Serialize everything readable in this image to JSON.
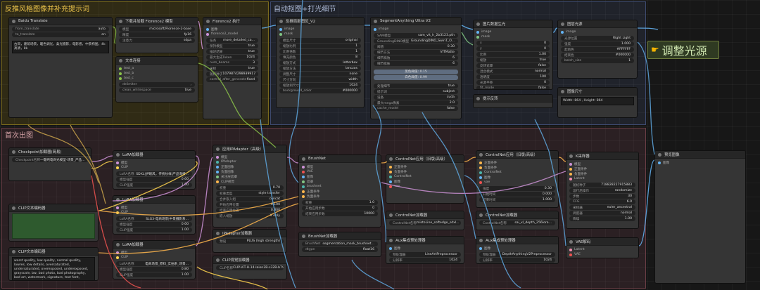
{
  "groups": [
    {
      "id": "g1",
      "title": "反推风格图像并补充提示词",
      "color": "#e8c14a",
      "bg": "rgba(140,120,20,0.22)",
      "border": "#7a6a1d"
    },
    {
      "id": "g2",
      "title": "自动抠图+打光细节",
      "color": "#aebbd8",
      "bg": "rgba(70,80,120,0.22)",
      "border": "#3d4a6e"
    },
    {
      "id": "g3",
      "title": "首次出图",
      "color": "#d7a4a8",
      "bg": "rgba(120,70,80,0.22)",
      "border": "#6a3d45"
    }
  ],
  "callout": {
    "icon": "pointing-hand-icon",
    "text": "调整光源"
  },
  "nodes": [
    {
      "id": "n1",
      "title": "Baidu Translate",
      "badge": "#285 MingNodes",
      "dot": "#888",
      "ports": [],
      "widgets": [
        {
          "k": "from_translate",
          "v": "auto"
        },
        {
          "k": "to_translate",
          "v": "en"
        }
      ],
      "text": "古风，建筑场景，暖色调光，柔光摄影，电影感，中景构图，4k高清，8k"
    },
    {
      "id": "n2",
      "title": "下载并加载 Florence2 模型",
      "badge": "#108 Florence2",
      "dot": "#888",
      "ports": [],
      "widgets": [
        {
          "k": "模型",
          "v": "microsoft/Florence-2-base"
        },
        {
          "k": "精度",
          "v": "fp16"
        },
        {
          "k": "注意力",
          "v": "sdpa"
        }
      ],
      "text": ""
    },
    {
      "id": "n3",
      "title": "文本连接",
      "badge": "",
      "dot": "#888",
      "ports": [
        {
          "n": "text_a",
          "c": "#8bc34a"
        },
        {
          "n": "text_b",
          "c": "#8bc34a"
        },
        {
          "n": "text_c",
          "c": "#8bc34a"
        }
      ],
      "widgets": [
        {
          "k": "delimiter",
          "v": ","
        },
        {
          "k": "clean_whitespace",
          "v": "true"
        }
      ],
      "text": ""
    },
    {
      "id": "n4",
      "title": "Florence2 执行",
      "badge": "#106 Florence2",
      "dot": "#888",
      "ports": [
        {
          "n": "图像",
          "c": "#64b5f6"
        },
        {
          "n": "florence2_model",
          "c": "#ce93d8"
        }
      ],
      "widgets": [
        {
          "k": "任务",
          "v": "more_detailed_ca..."
        },
        {
          "k": "保持模型",
          "v": "true"
        },
        {
          "k": "描述结果",
          "v": "true"
        },
        {
          "k": "最大生成Token",
          "v": "1024"
        },
        {
          "k": "num_beams",
          "v": "3"
        },
        {
          "k": "采样",
          "v": "true"
        },
        {
          "k": "随机种子",
          "v": "1079874298939917"
        },
        {
          "k": "control_after_generate",
          "v": "fixed"
        }
      ],
      "text": ""
    },
    {
      "id": "n5",
      "title": "反推局部图优_V2",
      "badge": "#200 LayerStyle",
      "dot": "#888",
      "ports": [
        {
          "n": "image",
          "c": "#64b5f6"
        },
        {
          "n": "mask",
          "c": "#81c784"
        }
      ],
      "widgets": [
        {
          "k": "模型尺寸",
          "v": "original"
        },
        {
          "k": "缩放比例",
          "v": "1"
        },
        {
          "k": "比例倍数",
          "v": "1"
        },
        {
          "k": "填充颜色",
          "v": "8"
        },
        {
          "k": "缩放方式",
          "v": "letterbox"
        },
        {
          "k": "缩放方法",
          "v": "lanczos"
        },
        {
          "k": "调整尺寸",
          "v": "none"
        },
        {
          "k": "尺寸方向",
          "v": "width"
        },
        {
          "k": "缩放到尺寸",
          "v": "1024"
        },
        {
          "k": "background_color",
          "v": "#000000"
        }
      ],
      "text": ""
    },
    {
      "id": "n6",
      "title": "SegmentAnything Ultra V2",
      "badge": "#64 LayerStyle",
      "dot": "#888",
      "ports": [
        {
          "n": "image",
          "c": "#64b5f6"
        }
      ],
      "widgets": [
        {
          "k": "SAM模型",
          "v": "sam_vit_h_2b3123.pth"
        },
        {
          "k": "GroundingDINO模型",
          "v": "GroundingDINO_SwinT_O..."
        },
        {
          "k": "阈值",
          "v": "0.30"
        },
        {
          "k": "细节方法",
          "v": "VITMatte"
        },
        {
          "k": "细节腐蚀",
          "v": "6"
        },
        {
          "k": "细节膨胀",
          "v": "6"
        }
      ],
      "buttons": [
        {
          "t": "黑色阈值: 0.15",
          "c": "blue"
        },
        {
          "t": "白色阈值: 0.99",
          "c": "blue"
        }
      ],
      "widgets2": [
        {
          "k": "处理细节",
          "v": "true"
        },
        {
          "k": "提示词",
          "v": "subject"
        },
        {
          "k": "设备",
          "v": "cuda"
        },
        {
          "k": "最大mega像素",
          "v": "2.0"
        },
        {
          "k": "cache_model",
          "v": "false"
        }
      ],
      "text": ""
    },
    {
      "id": "n7",
      "title": "图片数据生光",
      "badge": "#268 IC Nodes",
      "dot": "#888",
      "ports": [
        {
          "n": "image",
          "c": "#64b5f6"
        },
        {
          "n": "mask",
          "c": "#81c784"
        }
      ],
      "widgets": [
        {
          "k": "x",
          "v": "0"
        },
        {
          "k": "y",
          "v": "0"
        },
        {
          "k": "比例",
          "v": "1.00"
        },
        {
          "k": "缩放",
          "v": "true"
        },
        {
          "k": "反转遮罩",
          "v": "false"
        },
        {
          "k": "混合模式",
          "v": "normal"
        },
        {
          "k": "透明度",
          "v": "100"
        },
        {
          "k": "光源平移",
          "v": "0"
        },
        {
          "k": "fit_mode",
          "v": "false"
        }
      ],
      "text": ""
    },
    {
      "id": "n8",
      "title": "图层光源",
      "badge": "#159 IC-Light",
      "dot": "#888",
      "ports": [
        {
          "n": "image",
          "c": "#64b5f6"
        }
      ],
      "widgets": [
        {
          "k": "光源位置",
          "v": "Right Light"
        },
        {
          "k": "强度",
          "v": "1.000"
        },
        {
          "k": "起始色",
          "v": "#FFFFFF"
        },
        {
          "k": "结束色",
          "v": "#000000"
        },
        {
          "k": "batch_size",
          "v": "1"
        }
      ],
      "text": ""
    },
    {
      "id": "n9",
      "title": "图像尺寸",
      "badge": "#143 Easy-Use",
      "dot": "#888",
      "ports": [],
      "widgets": [],
      "text": "Width: 864 , Height: 864"
    },
    {
      "id": "n10",
      "title": "提示反转",
      "badge": "#127",
      "dot": "#888",
      "ports": [],
      "widgets": [],
      "text": ""
    },
    {
      "id": "n11",
      "title": "Checkpoint加载器(简易)",
      "badge": "#61",
      "dot": "#888",
      "ports": [],
      "widgets": [
        {
          "k": "Checkpoint名称",
          "v": "一键纯电商光模型-场景_产品..."
        }
      ],
      "text": ""
    },
    {
      "id": "n12",
      "title": "CLIP文本编码器",
      "badge": "#67",
      "dot": "#888",
      "ports": [],
      "widgets": [],
      "text": "",
      "green": true
    },
    {
      "id": "n13",
      "title": "CLIP文本编码器",
      "badge": "#68",
      "dot": "#888",
      "ports": [],
      "widgets": [],
      "text": "worst quality, low quality, normal quality, lowres, low details, oversaturated, undersaturated, overexposed, underexposed, grayscale, bw, bad photo, bad photography, bad art, watermark, signature, text font, username, error, logo"
    },
    {
      "id": "n14",
      "title": "LoRA加载器",
      "badge": "#63",
      "dot": "#888",
      "ports": [
        {
          "n": "模型",
          "c": "#ce93d8"
        },
        {
          "n": "CLIP",
          "c": "#ffd54f"
        }
      ],
      "widgets": [
        {
          "k": "LoRA名称",
          "v": "SDXL|护眼风，传统纹样|产品海报..."
        },
        {
          "k": "模型强度",
          "v": "0.60"
        },
        {
          "k": "CLIP强度",
          "v": "1.00"
        }
      ],
      "text": ""
    },
    {
      "id": "n15",
      "title": "LoRA加载器",
      "badge": "",
      "dot": "#888",
      "ports": [
        {
          "n": "模型",
          "c": "#ce93d8"
        },
        {
          "n": "CLIP",
          "c": "#ffd54f"
        }
      ],
      "widgets": [
        {
          "k": "LoRA名称",
          "v": "SLG3-电商场景|中景摄影系..."
        },
        {
          "k": "模型强度",
          "v": "0.60"
        },
        {
          "k": "CLIP强度",
          "v": "1.00"
        }
      ],
      "text": ""
    },
    {
      "id": "n16",
      "title": "LoRA加载器",
      "badge": "#269",
      "dot": "#888",
      "ports": [
        {
          "n": "模型",
          "c": "#ce93d8"
        },
        {
          "n": "CLIP",
          "c": "#ffd54f"
        }
      ],
      "widgets": [
        {
          "k": "LoRA名称",
          "v": "电商场景_原料_实拍系_场景..."
        },
        {
          "k": "模型强度",
          "v": "0.80"
        },
        {
          "k": "CLIP强度",
          "v": "1.00"
        }
      ],
      "text": ""
    },
    {
      "id": "n17",
      "title": "应用IPAdapter（高级）",
      "badge": "#85 IPAdapter_plus",
      "dot": "#888",
      "ports": [
        {
          "n": "模型",
          "c": "#ce93d8"
        },
        {
          "n": "IPAdapter",
          "c": "#4db6ac"
        },
        {
          "n": "正面图像",
          "c": "#64b5f6"
        },
        {
          "n": "负面图像",
          "c": "#64b5f6"
        },
        {
          "n": "关注层遮罩",
          "c": "#81c784"
        },
        {
          "n": "CLIP视觉",
          "c": "#ffb74d"
        }
      ],
      "widgets": [
        {
          "k": "权重",
          "v": "0.70"
        },
        {
          "k": "权重类型",
          "v": "style transfer"
        },
        {
          "k": "合并嵌入组",
          "v": "concat"
        },
        {
          "k": "开始应用位置",
          "v": "0.100"
        },
        {
          "k": "结束应用位置",
          "v": "0.800"
        },
        {
          "k": "嵌入缩放",
          "v": "V only"
        }
      ],
      "text": ""
    },
    {
      "id": "n18",
      "title": "IPAdapter加载器",
      "badge": "#82 IPAdapter_plus",
      "dot": "#888",
      "ports": [],
      "widgets": [
        {
          "k": "预设",
          "v": "PLUS (high strength)"
        }
      ],
      "text": ""
    },
    {
      "id": "n19",
      "title": "CLIP视觉加载器",
      "badge": "#83",
      "dot": "#888",
      "ports": [],
      "widgets": [
        {
          "k": "CLIP名称",
          "v": "CLIP-ViT-H-14-laion2B-s32B-b79K"
        }
      ],
      "text": ""
    },
    {
      "id": "n20",
      "title": "BrushNet",
      "badge": "#53 BrushNet",
      "dot": "#888",
      "ports": [
        {
          "n": "模型",
          "c": "#ce93d8"
        },
        {
          "n": "VAE",
          "c": "#ef5350"
        },
        {
          "n": "图像",
          "c": "#64b5f6"
        },
        {
          "n": "遮罩",
          "c": "#81c784"
        },
        {
          "n": "brushnet",
          "c": "#4db6ac"
        },
        {
          "n": "正面条件",
          "c": "#ffb74d"
        },
        {
          "n": "负面条件",
          "c": "#ffb74d"
        }
      ],
      "widgets": [
        {
          "k": "权重",
          "v": "1.0"
        },
        {
          "k": "开始应用步数",
          "v": "0"
        },
        {
          "k": "结束应用步数",
          "v": "10000"
        }
      ],
      "text": ""
    },
    {
      "id": "n21",
      "title": "BrushNet加载器",
      "badge": "",
      "dot": "#888",
      "ports": [],
      "widgets": [
        {
          "k": "BrushNet",
          "v": "segmentation_mask_brushnet..."
        },
        {
          "k": "dtype",
          "v": "float16"
        }
      ],
      "text": ""
    },
    {
      "id": "n22",
      "title": "ControlNet应用（旧版/高级）",
      "badge": "#81",
      "dot": "#888",
      "ports": [
        {
          "n": "正面条件",
          "c": "#ffb74d"
        },
        {
          "n": "负面条件",
          "c": "#ffb74d"
        },
        {
          "n": "ControlNet",
          "c": "#4db6ac"
        },
        {
          "n": "图像",
          "c": "#64b5f6"
        },
        {
          "n": "vae",
          "c": "#ef5350"
        }
      ],
      "widgets": [],
      "text": ""
    },
    {
      "id": "n23",
      "title": "ControlNet加载器",
      "badge": "",
      "dot": "#888",
      "ports": [],
      "widgets": [
        {
          "k": "ControlNet名称",
          "v": "mistoLine_softedge_sdxl..."
        }
      ],
      "text": ""
    },
    {
      "id": "n24",
      "title": "Aux集成预处理器",
      "badge": "",
      "dot": "#888",
      "ports": [
        {
          "n": "图像",
          "c": "#64b5f6"
        }
      ],
      "widgets": [
        {
          "k": "预处理器",
          "v": "LineArtPreprocessor"
        },
        {
          "k": "分辨率",
          "v": "1024"
        }
      ],
      "text": ""
    },
    {
      "id": "n25",
      "title": "ControlNet应用（旧版/高级）",
      "badge": "#256",
      "dot": "#888",
      "ports": [
        {
          "n": "正面条件",
          "c": "#ffb74d"
        },
        {
          "n": "负面条件",
          "c": "#ffb74d"
        },
        {
          "n": "ControlNet",
          "c": "#4db6ac"
        },
        {
          "n": "图像",
          "c": "#64b5f6"
        },
        {
          "n": "vae",
          "c": "#ef5350"
        }
      ],
      "widgets": [
        {
          "k": "强度",
          "v": "0.30"
        },
        {
          "k": "开始时间",
          "v": "0.000"
        },
        {
          "k": "结束时间",
          "v": "1.000"
        }
      ],
      "text": ""
    },
    {
      "id": "n26",
      "title": "ControlNet加载器",
      "badge": "",
      "dot": "#888",
      "ports": [],
      "widgets": [
        {
          "k": "ControlNet名称",
          "v": "sai_xl_depth_256lora..."
        }
      ],
      "text": ""
    },
    {
      "id": "n27",
      "title": "Aux集成预处理器",
      "badge": "",
      "dot": "#888",
      "ports": [
        {
          "n": "图像",
          "c": "#64b5f6"
        }
      ],
      "widgets": [
        {
          "k": "预处理器",
          "v": "DepthAnythingV2Preprocessor"
        },
        {
          "k": "分辨率",
          "v": "1024"
        }
      ],
      "text": ""
    },
    {
      "id": "n28",
      "title": "K采样器",
      "badge": "#55",
      "dot": "#888",
      "ports": [
        {
          "n": "模型",
          "c": "#ce93d8"
        },
        {
          "n": "正面条件",
          "c": "#ffb74d"
        },
        {
          "n": "负面条件",
          "c": "#ffb74d"
        },
        {
          "n": "Latent",
          "c": "#f48fb1"
        }
      ],
      "widgets": [
        {
          "k": "随机种子",
          "v": "718828227915883"
        },
        {
          "k": "运行后操作",
          "v": "randomize"
        },
        {
          "k": "步数",
          "v": "30"
        },
        {
          "k": "CFG",
          "v": "6.0"
        },
        {
          "k": "采样器",
          "v": "euler_ancestral"
        },
        {
          "k": "调度器",
          "v": "normal"
        },
        {
          "k": "降噪",
          "v": "1.00"
        }
      ],
      "text": ""
    },
    {
      "id": "n29",
      "title": "VAE解码",
      "badge": "#",
      "dot": "#888",
      "ports": [
        {
          "n": "Latent",
          "c": "#f48fb1"
        },
        {
          "n": "VAE",
          "c": "#ef5350"
        }
      ],
      "widgets": [],
      "text": ""
    },
    {
      "id": "n30",
      "title": "预览图像",
      "badge": "#221",
      "dot": "#888",
      "ports": [
        {
          "n": "图像",
          "c": "#64b5f6"
        }
      ],
      "widgets": [],
      "text": ""
    }
  ]
}
